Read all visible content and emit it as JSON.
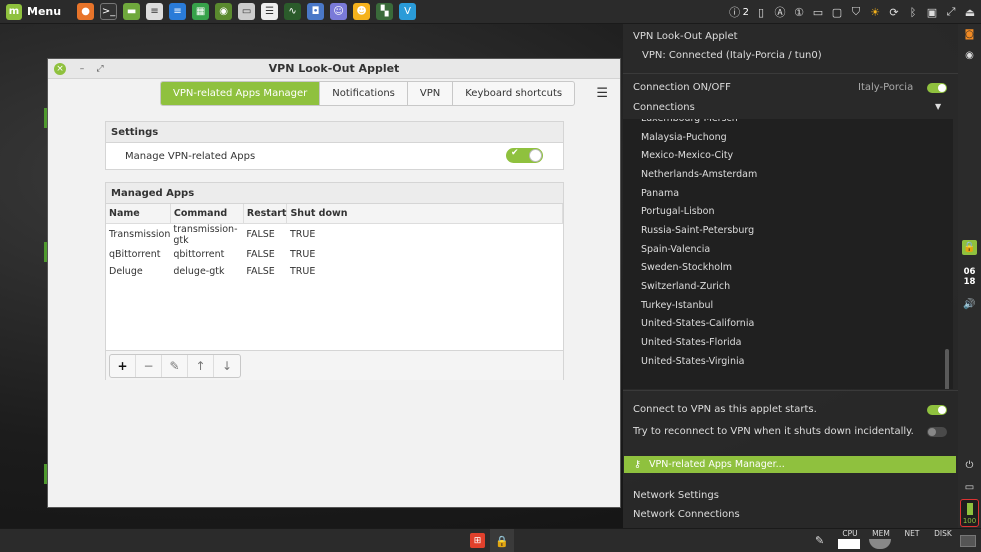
{
  "top_panel": {
    "menu_label": "Menu",
    "tray_workspace_number": "2"
  },
  "window": {
    "title": "VPN Look-Out Applet",
    "tabs": [
      {
        "label": "VPN-related Apps Manager",
        "active": true
      },
      {
        "label": "Notifications",
        "active": false
      },
      {
        "label": "VPN",
        "active": false
      },
      {
        "label": "Keyboard shortcuts",
        "active": false
      }
    ],
    "settings_header": "Settings",
    "manage_apps_label": "Manage VPN-related Apps",
    "manage_apps_enabled": true,
    "managed_apps_header": "Managed Apps",
    "columns": [
      "Name",
      "Command",
      "Restart",
      "Shut down"
    ],
    "rows": [
      {
        "name": "Transmission",
        "command": "transmission-gtk",
        "restart": "FALSE",
        "shutdown": "TRUE"
      },
      {
        "name": "qBittorrent",
        "command": "qbittorrent",
        "restart": "FALSE",
        "shutdown": "TRUE"
      },
      {
        "name": "Deluge",
        "command": "deluge-gtk",
        "restart": "FALSE",
        "shutdown": "TRUE"
      }
    ],
    "toolbar": {
      "add": "+",
      "remove": "−",
      "edit": "✎",
      "up": "↑",
      "down": "↓"
    }
  },
  "applet": {
    "title": "VPN Look-Out Applet",
    "status": "VPN: Connected (Italy-Porcia / tun0)",
    "connection_toggle_label": "Connection ON/OFF",
    "current_connection": "Italy-Porcia",
    "connection_on": true,
    "connections_label": "Connections",
    "connections": [
      "Luxembourg-Mersch",
      "Malaysia-Puchong",
      "Mexico-Mexico-City",
      "Netherlands-Amsterdam",
      "Panama",
      "Portugal-Lisbon",
      "Russia-Saint-Petersburg",
      "Spain-Valencia",
      "Sweden-Stockholm",
      "Switzerland-Zurich",
      "Turkey-Istanbul",
      "United-States-California",
      "United-States-Florida",
      "United-States-Virginia"
    ],
    "connect_on_start_label": "Connect to VPN as this applet starts.",
    "connect_on_start": true,
    "reconnect_label": "Try to reconnect to VPN when it shuts down incidentally.",
    "reconnect": false,
    "apps_manager_button": "VPN-related Apps Manager...",
    "network_settings": "Network Settings",
    "network_connections": "Network Connections"
  },
  "right_panel": {
    "clock_hour": "06",
    "clock_minute": "18",
    "battery_level": "100"
  },
  "bottom_panel": {
    "monitors": [
      "CPU",
      "MEM",
      "NET",
      "DISK"
    ]
  },
  "colors": {
    "accent": "#8fc13e",
    "panel_bg": "#2b2b2b",
    "applet_bg": "#2a2a2a"
  }
}
